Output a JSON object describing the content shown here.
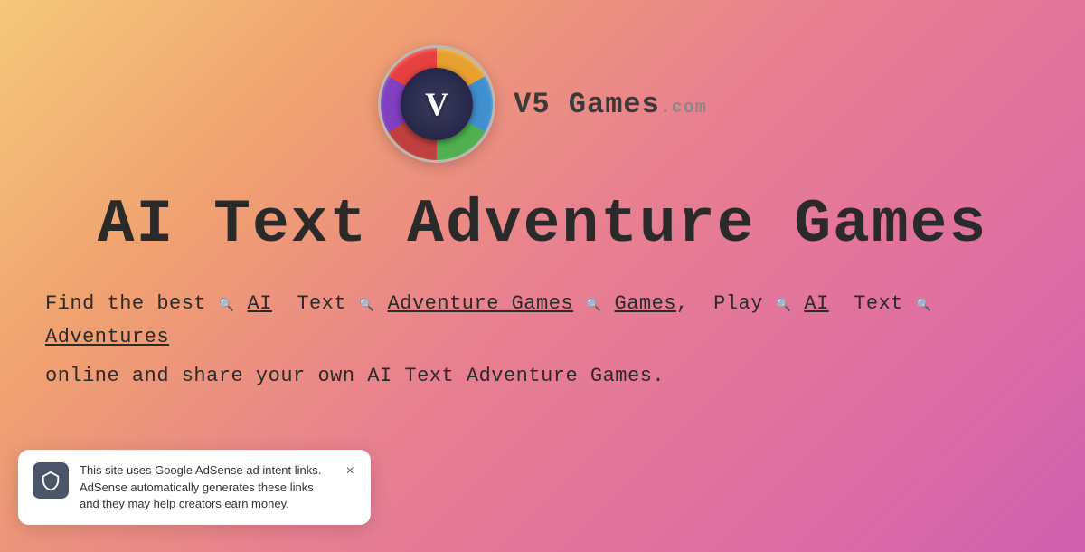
{
  "logo": {
    "title": "V5 Games",
    "domain": ".com",
    "v_letter": "V"
  },
  "page": {
    "title": "AI Text Adventure Games",
    "description_line1": "Find the best",
    "description_links": [
      "AI",
      "Text",
      "Adventure Games",
      "Games",
      "AI",
      "Text",
      "Adventures"
    ],
    "description_middle": ", Play",
    "description_line2": "online and share your own AI Text Adventure Games.",
    "full_desc_line1": "Find the best   AI  Text   Adventure Games  Games , Play   AI  Text   Adventures",
    "full_desc_line2": "online and share your own AI Text Adventure Games."
  },
  "toast": {
    "icon": "🛡",
    "text": "This site uses Google AdSense ad intent links. AdSense automatically generates these links and they may help creators earn money.",
    "close_label": "×"
  }
}
